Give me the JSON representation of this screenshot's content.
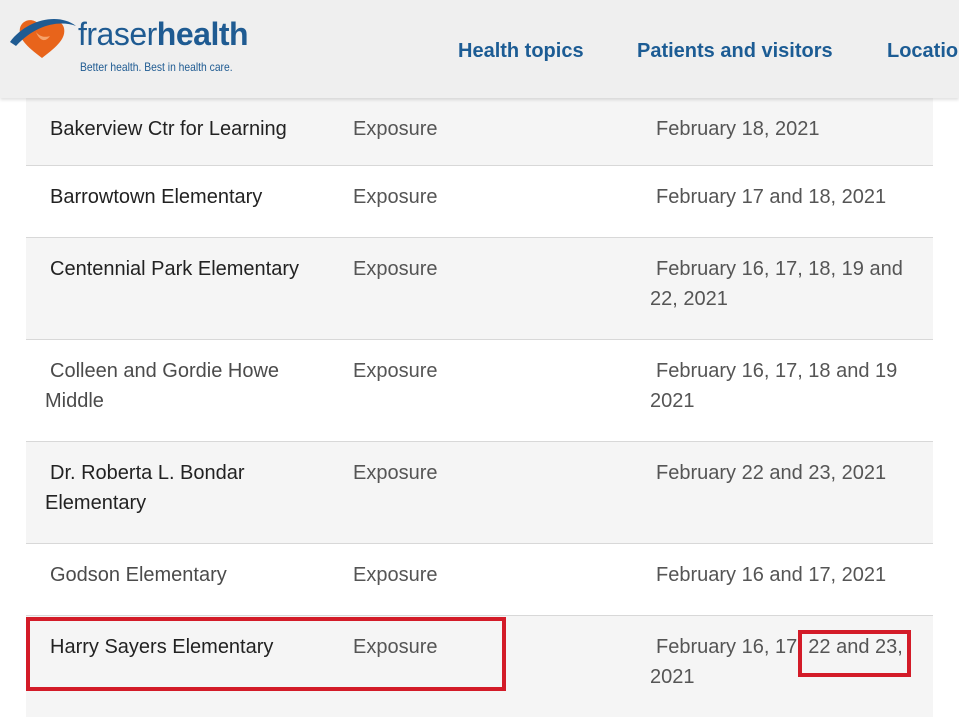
{
  "header": {
    "logo": {
      "word_part1": "fraser",
      "word_part2": "health",
      "tagline": "Better health. Best in health care."
    },
    "nav": [
      {
        "label": "Health topics"
      },
      {
        "label": "Patients and visitors"
      },
      {
        "label": "Locatio"
      }
    ]
  },
  "exposures": {
    "rows": [
      {
        "school": "Bakerview Ctr for Learning",
        "type": "Exposure",
        "dates": "February 18, 2021"
      },
      {
        "school": "Barrowtown Elementary",
        "type": "Exposure",
        "dates": "February 17 and 18, 2021"
      },
      {
        "school": "Centennial Park Elementary",
        "type": "Exposure",
        "dates": "February 16, 17, 18, 19 and 22, 2021"
      },
      {
        "school": "Colleen and Gordie Howe Middle",
        "type": "Exposure",
        "dates": "February 16, 17, 18 and 19 2021"
      },
      {
        "school": "Dr. Roberta L. Bondar Elementary",
        "type": "Exposure",
        "dates": "February 22 and 23, 2021"
      },
      {
        "school": "Godson Elementary",
        "type": "Exposure",
        "dates": "February 16 and 17, 2021"
      },
      {
        "school": "Harry Sayers Elementary",
        "type": "Exposure",
        "dates": "February 16, 17, 22 and 23, 2021"
      }
    ]
  },
  "annotations": {
    "highlight_color": "#d31b28"
  },
  "colors": {
    "brand_blue": "#1f5b92",
    "brand_orange": "#e8641b",
    "header_bg": "#efefef",
    "row_shaded": "#f5f5f5"
  }
}
